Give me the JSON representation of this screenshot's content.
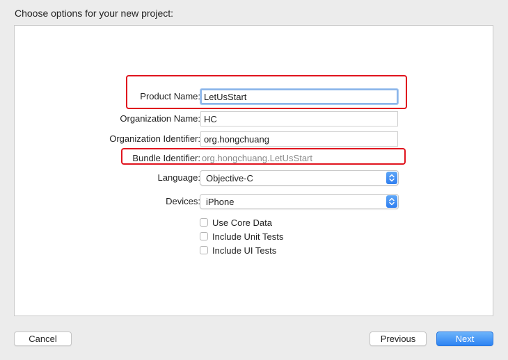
{
  "window": {
    "title": "Choose options for your new project:"
  },
  "form": {
    "product_name": {
      "label": "Product Name:",
      "value": "LetUsStart"
    },
    "organization_name": {
      "label": "Organization Name:",
      "value": "HC"
    },
    "organization_identifier": {
      "label": "Organization Identifier:",
      "value": "org.hongchuang"
    },
    "bundle_identifier": {
      "label": "Bundle Identifier:",
      "value": "org.hongchuang.LetUsStart"
    },
    "language": {
      "label": "Language:",
      "selected": "Objective-C"
    },
    "devices": {
      "label": "Devices:",
      "selected": "iPhone"
    },
    "checkboxes": [
      {
        "label": "Use Core Data",
        "checked": false
      },
      {
        "label": "Include Unit Tests",
        "checked": false
      },
      {
        "label": "Include UI Tests",
        "checked": false
      }
    ]
  },
  "buttons": {
    "cancel": "Cancel",
    "previous": "Previous",
    "next": "Next"
  },
  "colors": {
    "highlight": "#e0141e",
    "accent": "#2d83f3",
    "focus_ring": "#8cb6ea"
  }
}
